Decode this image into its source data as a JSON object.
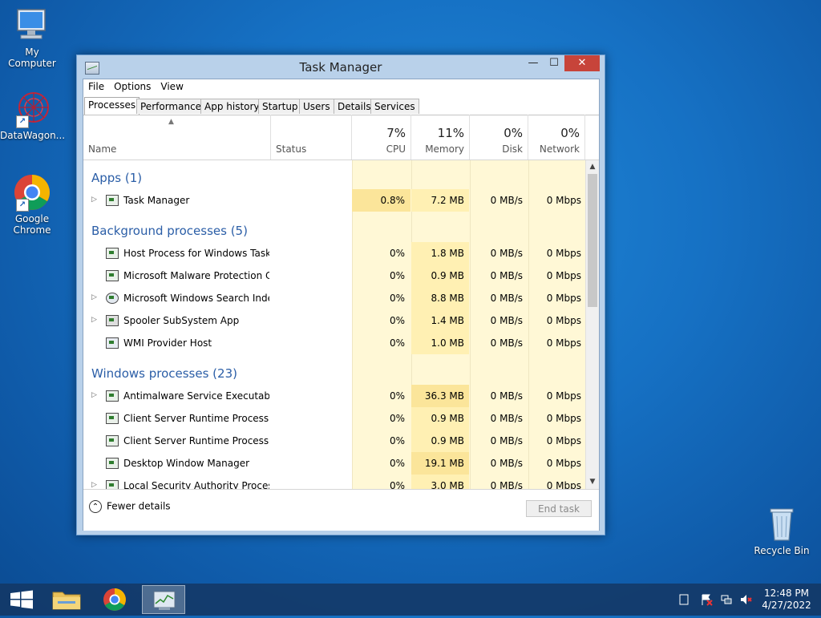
{
  "desktop": {
    "icons": [
      {
        "label": "My Computer"
      },
      {
        "label": "DataWagon..."
      },
      {
        "label": "Google\nChrome"
      },
      {
        "label": "Recycle Bin"
      }
    ]
  },
  "window": {
    "title": "Task Manager",
    "buttons": {
      "minimize": "—",
      "maximize": "☐",
      "close": "✕"
    },
    "menu": [
      "File",
      "Options",
      "View"
    ],
    "tabs": [
      "Processes",
      "Performance",
      "App history",
      "Startup",
      "Users",
      "Details",
      "Services"
    ],
    "active_tab": "Processes",
    "columns": {
      "name": "Name",
      "status": "Status",
      "cpu": {
        "pct": "7%",
        "label": "CPU"
      },
      "memory": {
        "pct": "11%",
        "label": "Memory"
      },
      "disk": {
        "pct": "0%",
        "label": "Disk"
      },
      "network": {
        "pct": "0%",
        "label": "Network"
      }
    },
    "groups": [
      {
        "title": "Apps (1)"
      },
      {
        "title": "Background processes (5)"
      },
      {
        "title": "Windows processes (23)"
      }
    ],
    "processes": [
      {
        "name": "Task Manager",
        "cpu": "0.8%",
        "mem": "7.2 MB",
        "disk": "0 MB/s",
        "net": "0 Mbps"
      },
      {
        "name": "Host Process for Windows Tasks",
        "cpu": "0%",
        "mem": "1.8 MB",
        "disk": "0 MB/s",
        "net": "0 Mbps"
      },
      {
        "name": "Microsoft Malware Protection C...",
        "cpu": "0%",
        "mem": "0.9 MB",
        "disk": "0 MB/s",
        "net": "0 Mbps"
      },
      {
        "name": "Microsoft Windows Search Inde...",
        "cpu": "0%",
        "mem": "8.8 MB",
        "disk": "0 MB/s",
        "net": "0 Mbps"
      },
      {
        "name": "Spooler SubSystem App",
        "cpu": "0%",
        "mem": "1.4 MB",
        "disk": "0 MB/s",
        "net": "0 Mbps"
      },
      {
        "name": "WMI Provider Host",
        "cpu": "0%",
        "mem": "1.0 MB",
        "disk": "0 MB/s",
        "net": "0 Mbps"
      },
      {
        "name": "Antimalware Service Executable",
        "cpu": "0%",
        "mem": "36.3 MB",
        "disk": "0 MB/s",
        "net": "0 Mbps"
      },
      {
        "name": "Client Server Runtime Process",
        "cpu": "0%",
        "mem": "0.9 MB",
        "disk": "0 MB/s",
        "net": "0 Mbps"
      },
      {
        "name": "Client Server Runtime Process",
        "cpu": "0%",
        "mem": "0.9 MB",
        "disk": "0 MB/s",
        "net": "0 Mbps"
      },
      {
        "name": "Desktop Window Manager",
        "cpu": "0%",
        "mem": "19.1 MB",
        "disk": "0 MB/s",
        "net": "0 Mbps"
      },
      {
        "name": "Local Security Authority Process",
        "cpu": "0%",
        "mem": "3.0 MB",
        "disk": "0 MB/s",
        "net": "0 Mbps"
      }
    ],
    "footer": {
      "fewer_details": "Fewer details",
      "end_task": "End task"
    }
  },
  "taskbar": {
    "clock_time": "12:48 PM",
    "clock_date": "4/27/2022"
  },
  "colors": {
    "heat_light": "#fff8d6",
    "heat_mid": "#fff0b3",
    "heat_strong": "#fbe59a",
    "group_title": "#2b5ea7"
  }
}
